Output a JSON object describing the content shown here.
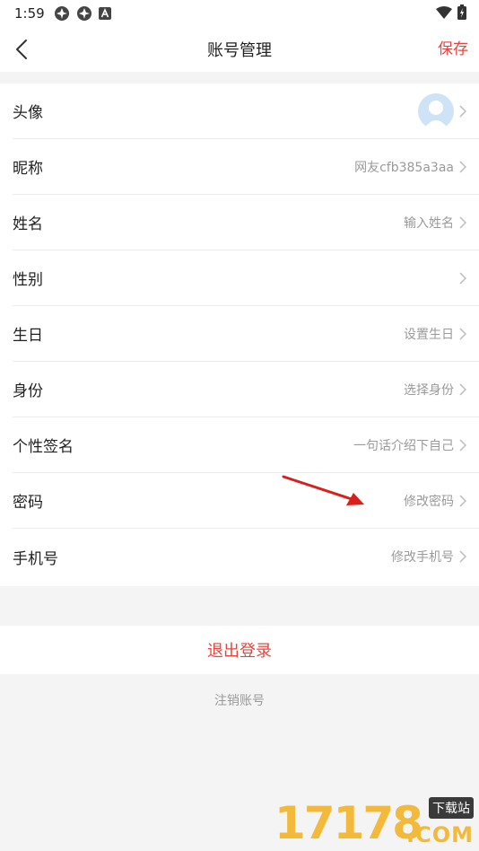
{
  "status_bar": {
    "time": "1:59",
    "icons": [
      "app-icon",
      "app-icon",
      "a-icon"
    ],
    "right_icons": [
      "wifi-icon",
      "battery-icon"
    ]
  },
  "header": {
    "title": "账号管理",
    "save_label": "保存"
  },
  "rows": [
    {
      "label": "头像",
      "value": ""
    },
    {
      "label": "昵称",
      "value": "网友cfb385a3aa"
    },
    {
      "label": "姓名",
      "value": "输入姓名"
    },
    {
      "label": "性别",
      "value": ""
    },
    {
      "label": "生日",
      "value": "设置生日"
    },
    {
      "label": "身份",
      "value": "选择身份"
    },
    {
      "label": "个性签名",
      "value": "一句话介绍下自己"
    },
    {
      "label": "密码",
      "value": "修改密码"
    },
    {
      "label": "手机号",
      "value": "修改手机号"
    }
  ],
  "logout_label": "退出登录",
  "deactivate_label": "注销账号",
  "watermark": {
    "number": "17178",
    "tag": "下载站",
    "suffix": ".COM"
  },
  "colors": {
    "accent": "#e8443e",
    "background": "#f4f4f4",
    "secondary_text": "#9a9a9a",
    "avatar_bg": "#cfe3f7",
    "watermark": "#f3b93b"
  }
}
